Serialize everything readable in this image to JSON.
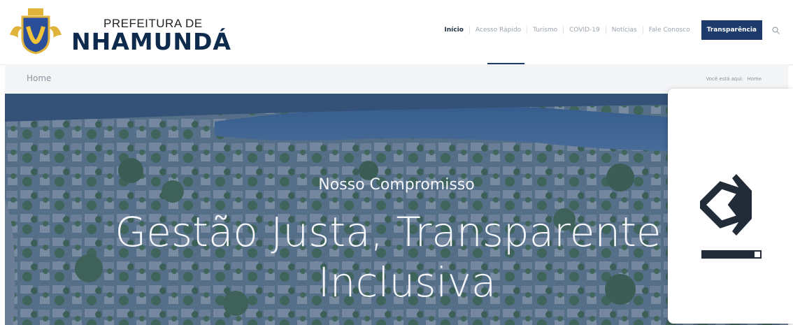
{
  "header": {
    "logo_top": "PREFEITURA DE",
    "logo_main": "NHAMUNDÁ",
    "nav": [
      {
        "label": "Início",
        "active": true
      },
      {
        "label": "Acesso Rápido"
      },
      {
        "label": "Turismo"
      },
      {
        "label": "COVID-19"
      },
      {
        "label": "Notícias"
      },
      {
        "label": "Fale Conosco"
      }
    ],
    "button_label": "Transparência",
    "search_icon": "search-icon"
  },
  "breadcrumb": {
    "title": "Home",
    "prefix": "Você está aqui:",
    "current": "Home"
  },
  "hero": {
    "subtitle": "Nosso Compromisso",
    "title": "Gestão Justa, Transparente e Inclusiva"
  },
  "panel": {
    "icon": "unity-logo-icon",
    "progress": 0.88
  },
  "colors": {
    "brand_navy": "#1d3a6b",
    "nav_text": "#9aa3ad",
    "crumb_bg": "#f3f4f6"
  }
}
